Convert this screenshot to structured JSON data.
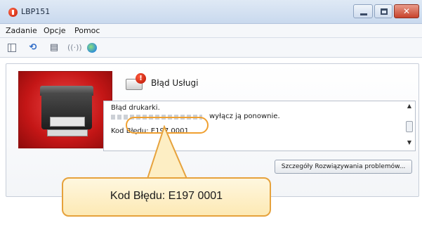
{
  "window": {
    "title": "LBP151"
  },
  "menu": {
    "items": [
      "Zadanie",
      "Opcje",
      "Pomoc"
    ]
  },
  "toolbar": {
    "icons": [
      "queue-icon",
      "refresh-icon",
      "printer-info-icon",
      "wireless-icon",
      "globe-icon"
    ]
  },
  "status": {
    "title": "Błąd Usługi",
    "message_line1": "Błąd drukarki.",
    "message_line2": "wyłącz ją ponownie.",
    "error_code": "Kod Błędu: E197 0001"
  },
  "details_button": {
    "label": "Szczegóły Rozwiązywania problemów..."
  },
  "callout": {
    "text": "Kod Błędu: E197 0001"
  },
  "colors": {
    "callout_border": "#e6a23c",
    "callout_fill": "#fde9b4",
    "printer_panel": "#c41616",
    "error_icon": "#c41d08"
  }
}
